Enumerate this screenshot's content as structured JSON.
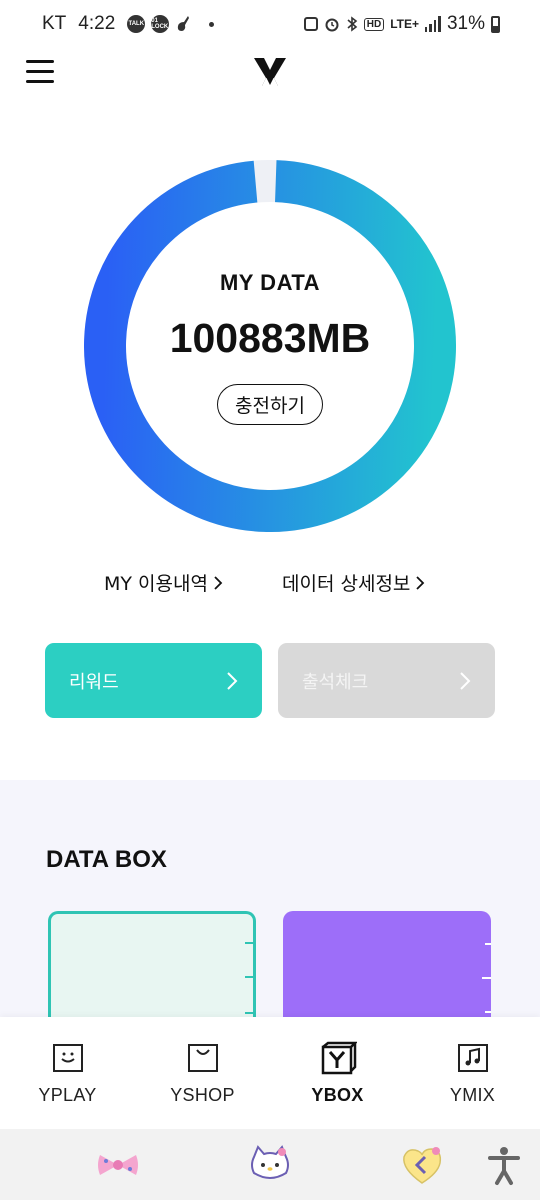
{
  "status_bar": {
    "carrier": "KT",
    "time": "4:22",
    "notif_icons": [
      "TALK",
      "01 LOCK"
    ],
    "network": "LTE+",
    "hd": "HD",
    "battery": "31%"
  },
  "header": {
    "menu_icon": "hamburger-icon",
    "logo_icon": "y-logo-icon"
  },
  "data_gauge": {
    "title": "MY DATA",
    "value": "100883MB",
    "remaining_fraction": 0.98,
    "charge_button": "충전하기",
    "colors": {
      "start": "#2a60f5",
      "end": "#22c4cf",
      "track": "#eef0f5"
    }
  },
  "links": {
    "usage": "MY 이용내역",
    "detail": "데이터 상세정보"
  },
  "actions": {
    "reward": "리워드",
    "attendance": "출석체크",
    "reward_color": "#2ccfc2",
    "attendance_color": "#d9d9d9"
  },
  "data_box": {
    "title": "DATA BOX",
    "card_colors": [
      "#e8f6f2",
      "#9d6ef9"
    ]
  },
  "bottom_nav": {
    "items": [
      {
        "label": "YPLAY",
        "icon": "play-box-icon",
        "active": false
      },
      {
        "label": "YSHOP",
        "icon": "shop-bag-icon",
        "active": false
      },
      {
        "label": "YBOX",
        "icon": "ybox-icon",
        "active": true
      },
      {
        "label": "YMIX",
        "icon": "music-note-icon",
        "active": false
      }
    ]
  },
  "system_nav": {
    "icons": [
      "bow-icon",
      "hello-kitty-icon",
      "back-heart-icon",
      "accessibility-icon"
    ]
  }
}
